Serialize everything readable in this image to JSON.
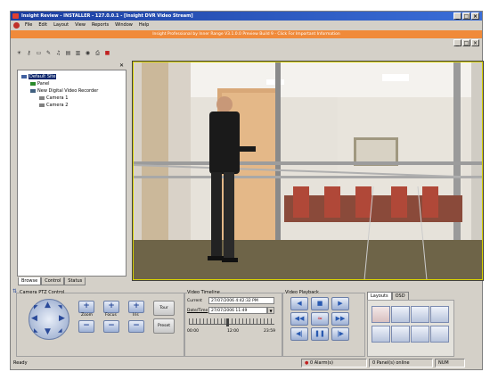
{
  "window": {
    "title": "Insight Review - INSTALLER - 127.0.0.1 - [Insight DVR Video Stream]",
    "controls": [
      "_",
      "□",
      "×"
    ]
  },
  "menu": [
    "File",
    "Edit",
    "Layout",
    "View",
    "Reports",
    "Window",
    "Help"
  ],
  "banner": "Insight Professional by Inner Range V3.1.0.0 Preview Build 9 - Click For Important Information",
  "tree": {
    "root": "Default Site",
    "panel": "Panel",
    "dvr": "New Digital Video Recorder",
    "cameras": [
      "Camera 1",
      "Camera 2"
    ]
  },
  "panel_tabs": [
    "Browse",
    "Control",
    "Status"
  ],
  "ptz": {
    "title": "Camera PTZ Control",
    "zoom": "Zoom",
    "focus": "Focus",
    "iris": "Iris",
    "tour": "Tour",
    "preset": "Preset"
  },
  "timeline": {
    "title": "Video Timeline",
    "current_label": "Current",
    "current_value": "27/07/2006 4:42:32 PM",
    "date_label": "Date/Time",
    "date_value": "27/07/2006 11:49",
    "ticks": [
      "00:00",
      "12:00",
      "23:59"
    ],
    "position": 0.45
  },
  "playback": {
    "title": "Video Playback"
  },
  "layouts": {
    "tabs": [
      "Layouts",
      "OSD"
    ]
  },
  "status": {
    "ready": "Ready",
    "alarms": "0 Alarm(s)",
    "panels": "0 Panel(s) online",
    "num": "NUM"
  },
  "colors": {
    "banner": "#f08a3a",
    "title": "#1c3fa0",
    "button": "#9db0d4"
  }
}
